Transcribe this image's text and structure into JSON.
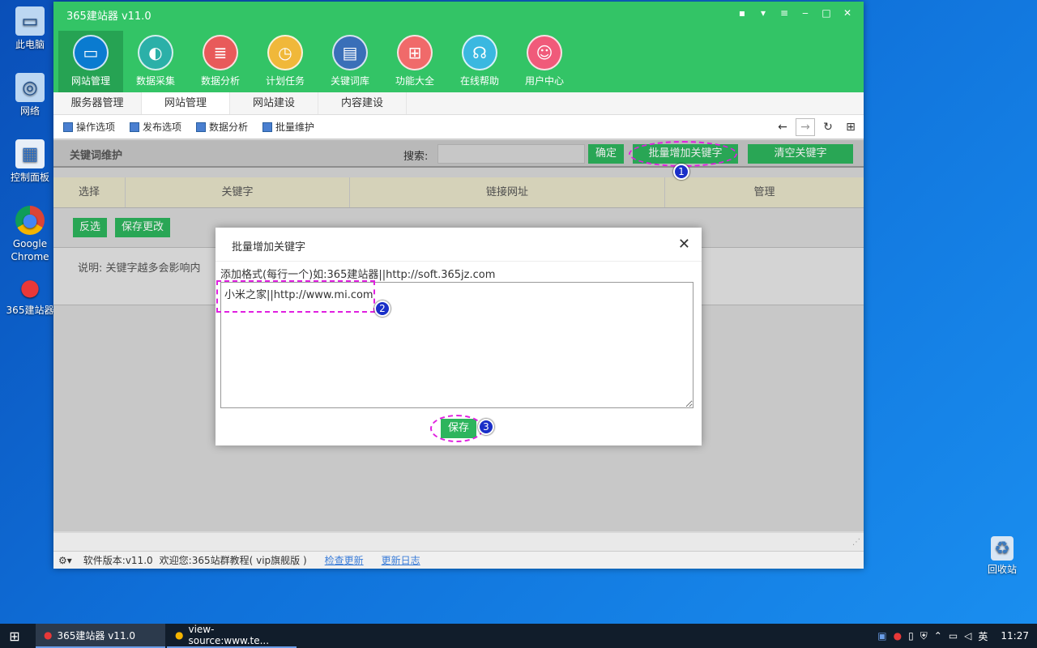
{
  "desktop": {
    "icons": [
      {
        "label": "此电脑",
        "icon": "computer-icon"
      },
      {
        "label": "网络",
        "icon": "network-icon"
      },
      {
        "label": "控制面板",
        "icon": "control-panel-icon"
      },
      {
        "label": "Google Chrome",
        "icon": "chrome-icon"
      },
      {
        "label": "365建站器",
        "icon": "apple-icon"
      },
      {
        "label": "回收站",
        "icon": "recycle-bin-icon"
      }
    ]
  },
  "app": {
    "title": "365建站器 v11.0",
    "nav": [
      {
        "label": "网站管理",
        "icon": "monitor-icon",
        "color": "#0a7bd0"
      },
      {
        "label": "数据采集",
        "icon": "edge-icon",
        "color": "#2bb0a8"
      },
      {
        "label": "数据分析",
        "icon": "database-icon",
        "color": "#e85a5a"
      },
      {
        "label": "计划任务",
        "icon": "gauge-icon",
        "color": "#f0b83a"
      },
      {
        "label": "关键词库",
        "icon": "book-icon",
        "color": "#3a6fb8"
      },
      {
        "label": "功能大全",
        "icon": "grid-icon",
        "color": "#f06a6a"
      },
      {
        "label": "在线帮助",
        "icon": "headset-icon",
        "color": "#3ab8e0"
      },
      {
        "label": "用户中心",
        "icon": "user-icon",
        "color": "#f05a7a"
      }
    ],
    "subtabs": [
      "服务器管理",
      "网站管理",
      "网站建设",
      "内容建设"
    ],
    "toolbar": [
      "操作选项",
      "发布选项",
      "数据分析",
      "批量维护"
    ],
    "keyword_section": {
      "title": "关键词维护",
      "search_label": "搜索:",
      "confirm": "确定",
      "batch_add": "批量增加关键字",
      "clear": "清空关键字"
    },
    "table": {
      "columns": [
        "选择",
        "关键字",
        "链接网址",
        "管理"
      ]
    },
    "actions": {
      "invert": "反选",
      "save_changes": "保存更改"
    },
    "note": "说明:  关键字越多会影响内",
    "status": {
      "version": "软件版本:v11.0",
      "welcome": "欢迎您:365站群教程( vip旗舰版 )",
      "check_update": "检查更新",
      "update_log": "更新日志"
    }
  },
  "modal": {
    "title": "批量增加关键字",
    "hint": "添加格式(每行一个)如:365建站器||http://soft.365jz.com",
    "text": "小米之家||http://www.mi.com",
    "save": "保存"
  },
  "annotations": [
    "1",
    "2",
    "3"
  ],
  "taskbar": {
    "apps": [
      "365建站器 v11.0",
      "view-source:www.te..."
    ],
    "ime": "英",
    "time": "11:27"
  }
}
